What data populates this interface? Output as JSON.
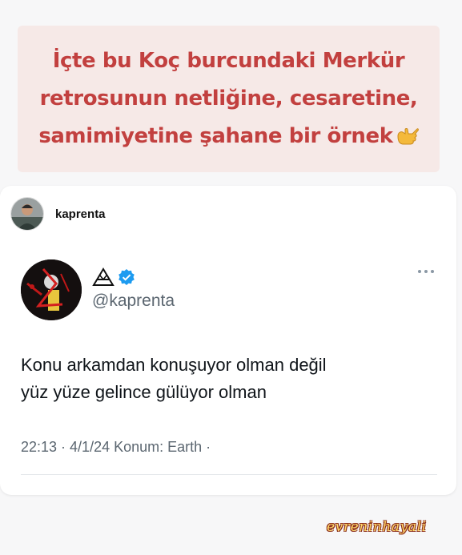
{
  "caption": {
    "lines": [
      "İçte bu Koç burcundaki Merkür",
      "retrosunun netliğine, cesaretine,",
      "samimiyetine şahane bir örnek"
    ],
    "emoji_icon": "call-me-hand-emoji",
    "color": "#c2403f",
    "background": "#f6e9e7"
  },
  "repost": {
    "username": "kaprenta"
  },
  "tweet": {
    "handle": "@kaprenta",
    "verified": true,
    "text_lines": [
      "Konu arkamdan konuşuyor olman değil",
      "yüz yüze gelince gülüyor olman"
    ],
    "meta": "22:13 · 4/1/24 Konum: Earth ·",
    "verified_color": "#1d9bf0"
  },
  "watermark": "evreninhayali"
}
